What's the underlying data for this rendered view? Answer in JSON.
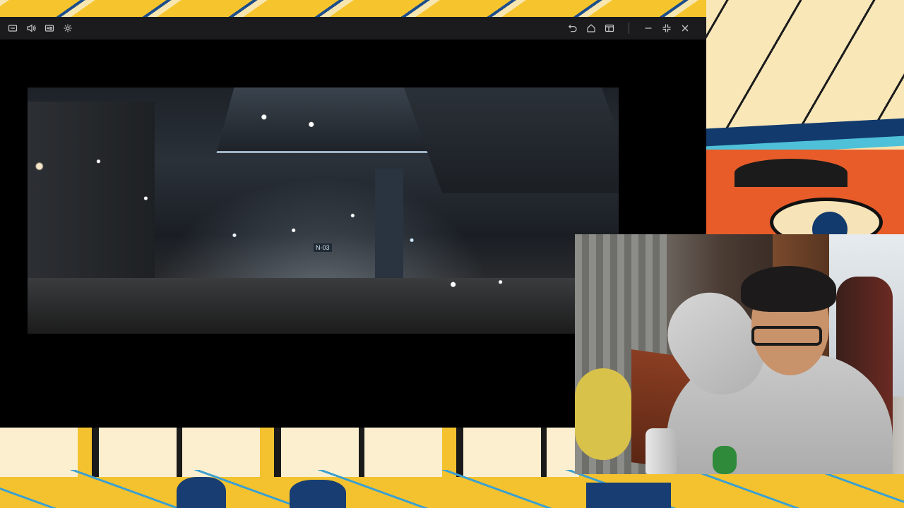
{
  "window": {
    "toolbar_left": [
      {
        "name": "screenshot-icon"
      },
      {
        "name": "volume-icon"
      },
      {
        "name": "hd-icon"
      },
      {
        "name": "settings-gear-icon"
      }
    ],
    "toolbar_right": [
      {
        "name": "back-arrow-icon"
      },
      {
        "name": "home-icon"
      },
      {
        "name": "window-layout-icon"
      }
    ],
    "window_controls": [
      "minimize-icon",
      "exit-fullscreen-icon",
      "close-icon"
    ]
  },
  "video": {
    "sign_text": "N-03"
  },
  "colors": {
    "titlebar_bg": "#1b1b1d",
    "icon_color": "#c8c8c8",
    "backdrop_yellow": "#f2c230",
    "backdrop_blue": "#173d72"
  }
}
